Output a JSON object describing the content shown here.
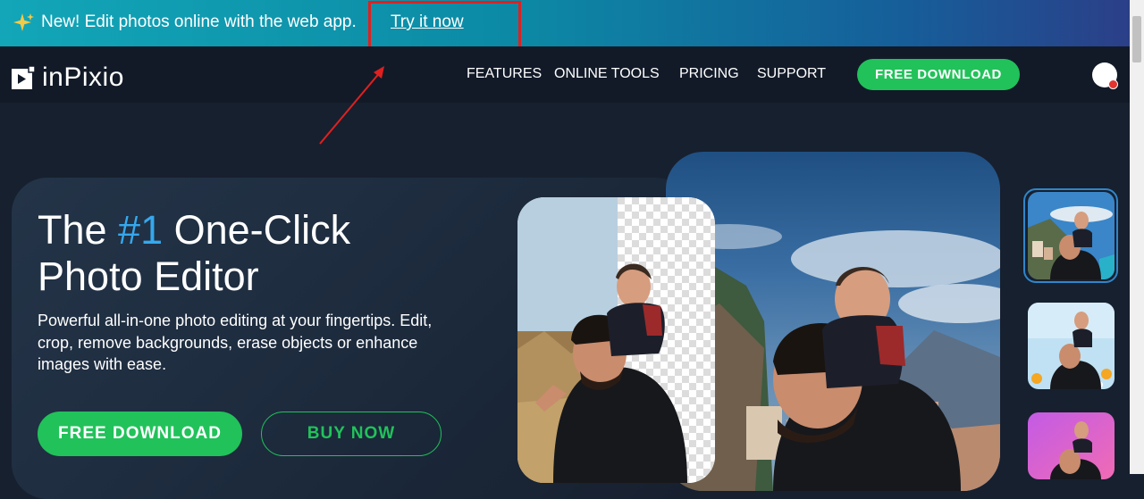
{
  "banner": {
    "text": "New! Edit photos online with the web app.",
    "link_label": "Try it now",
    "icon": "sparkle-icon"
  },
  "nav": {
    "logo_text": "inPixio",
    "items": [
      "FEATURES",
      "ONLINE TOOLS",
      "PRICING",
      "SUPPORT"
    ],
    "cta_label": "FREE DOWNLOAD",
    "avatar_icon": "avatar-icon"
  },
  "hero": {
    "headline_pre": "The ",
    "headline_accent": "#1",
    "headline_post": " One-Click",
    "headline_line2": "Photo Editor",
    "subtext": "Powerful all-in-one photo editing at your fingertips. Edit, crop, remove backgrounds, erase objects or enhance images with ease.",
    "primary_button": "FREE DOWNLOAD",
    "secondary_button": "BUY NOW"
  },
  "colors": {
    "accent_blue": "#35a8ee",
    "cta_green": "#21c25a",
    "highlight_red": "#e0201f"
  }
}
